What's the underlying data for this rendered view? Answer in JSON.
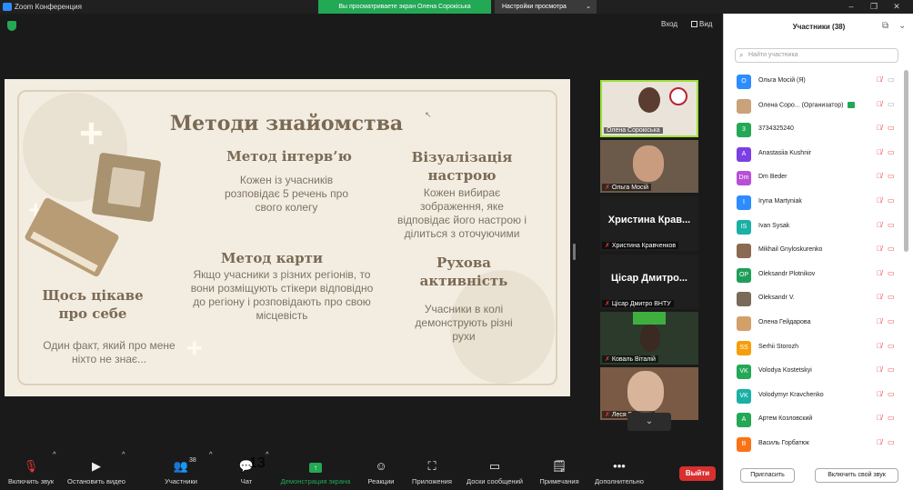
{
  "window": {
    "app_title": "Zoom Конференция",
    "share_banner": "Вы просматриваете экран Олена Сорокіська",
    "view_options": "Настройки просмотра"
  },
  "meeting": {
    "view_exit": "Вход",
    "view_label": "Вид"
  },
  "slide": {
    "title": "Методи знайомства",
    "interview_title": "Метод інтерв’ю",
    "interview_text": "Кожен із учасників розповідає 5 речень про свого колегу",
    "mood_title": "Візуалізація настрою",
    "mood_text": "Кожен вибирає зображення, яке відповідає його настрою і ділиться з оточуючими",
    "about_title": "Щось цікаве про себе",
    "about_text": "Один факт, який про мене ніхто не знає...",
    "map_title": "Метод карти",
    "map_text": "Якщо учасники з різних регіонів, то вони розміщують стікери відповідно до регіону і розповідають про свою місцевість",
    "motion_title": "Рухова активність",
    "motion_text": "Учасники в колі демонструють різні рухи"
  },
  "thumbnails": [
    {
      "label": "Олена Сорокіська",
      "big": "",
      "bg": "#e9e3da"
    },
    {
      "label": "Ольга Мосій",
      "big": "",
      "bg": "#6b5a4a"
    },
    {
      "label": "Христина Кравченков",
      "big": "Христина Крав...",
      "bg": "#1f1f1f"
    },
    {
      "label": "Цісар Дмитро ВНТУ",
      "big": "Цісар Дмитро...",
      "bg": "#1f1f1f"
    },
    {
      "label": "Коваль Віталій",
      "big": "",
      "bg": "#2c3a2c"
    },
    {
      "label": "Леся Галиняк",
      "big": "",
      "bg": "#7a5a45"
    }
  ],
  "toolbar": {
    "mute": "Включить звук",
    "video": "Остановить видео",
    "participants": "Участники",
    "participants_count": "38",
    "chat": "Чат",
    "chat_badge": "13",
    "share": "Демонстрация экрана",
    "reactions": "Реакции",
    "apps": "Приложения",
    "whiteboards": "Доски сообщений",
    "notes": "Примечания",
    "more": "Дополнительно",
    "leave": "Выйти"
  },
  "panel": {
    "title": "Участники (38)",
    "search_placeholder": "Найти участника",
    "invite": "Пригласить",
    "unmute_me": "Включить свой звук",
    "organizer_tag": "(Организатор)",
    "participants": [
      {
        "initial": "O",
        "name": "Ольга Мосій (Я)",
        "color": "#2d8cff",
        "cam_on": true
      },
      {
        "initial": "",
        "name": "Олена Соро...",
        "color": "#c9a27a",
        "cam_on": true,
        "organizer": true
      },
      {
        "initial": "3",
        "name": "3734325240",
        "color": "#23a855",
        "cam_on": false
      },
      {
        "initial": "A",
        "name": "Anastasiia Kushnir",
        "color": "#7b3fe4",
        "cam_on": false
      },
      {
        "initial": "Dm",
        "name": "Dm Beder",
        "color": "#b84fd8",
        "cam_on": false
      },
      {
        "initial": "I",
        "name": "Iryna Martyniak",
        "color": "#2d8cff",
        "cam_on": false
      },
      {
        "initial": "IS",
        "name": "Ivan Sysak",
        "color": "#1ab0a6",
        "cam_on": false
      },
      {
        "initial": "",
        "name": "Mikhail Gnyloskurenko",
        "color": "#8a6a50",
        "cam_on": false
      },
      {
        "initial": "OP",
        "name": "Oleksandr Plotnikov",
        "color": "#1e9e5a",
        "cam_on": false
      },
      {
        "initial": "",
        "name": "Oleksandr V.",
        "color": "#7a6a5a",
        "cam_on": false
      },
      {
        "initial": "",
        "name": "Олена Гейдарова",
        "color": "#d3a06a",
        "cam_on": false
      },
      {
        "initial": "SS",
        "name": "Serhii Storozh",
        "color": "#f59e0b",
        "cam_on": false
      },
      {
        "initial": "VK",
        "name": "Volodya Kostetskyi",
        "color": "#23a855",
        "cam_on": false
      },
      {
        "initial": "VK",
        "name": "Volodymyr Kravchenko",
        "color": "#1ab0a6",
        "cam_on": false
      },
      {
        "initial": "A",
        "name": "Артем Козловский",
        "color": "#23a855",
        "cam_on": false
      },
      {
        "initial": "B",
        "name": "Василь Горбатюк",
        "color": "#f97316",
        "cam_on": false
      }
    ]
  }
}
